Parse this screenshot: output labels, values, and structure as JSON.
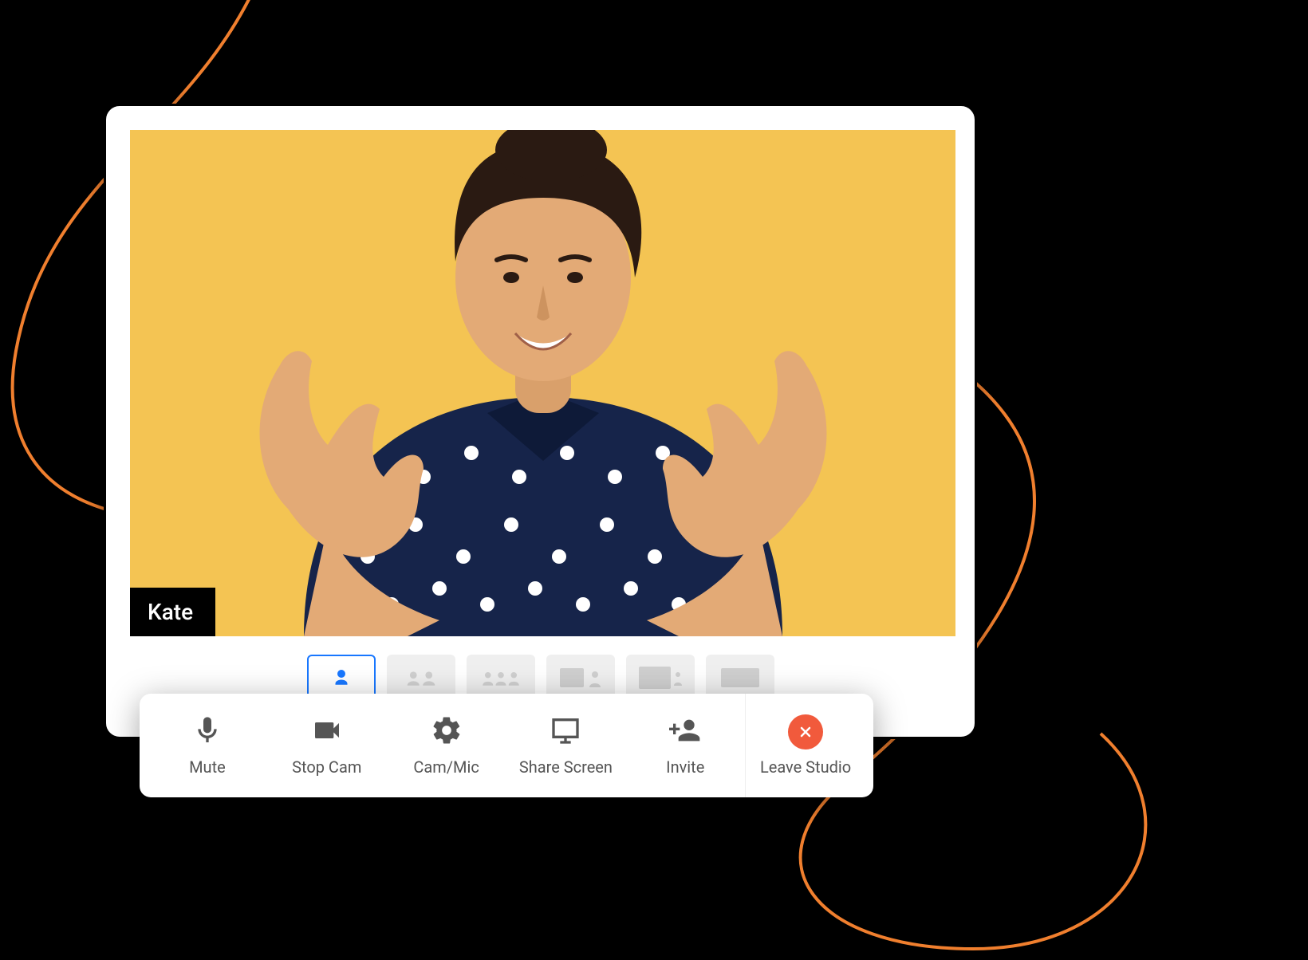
{
  "participant": {
    "name": "Kate"
  },
  "layouts": {
    "active_index": 0,
    "options": [
      "single",
      "two-up",
      "three-up",
      "screen-small",
      "screen-large",
      "screen-only"
    ]
  },
  "toolbar": {
    "mute": {
      "label": "Mute",
      "icon": "mic-icon"
    },
    "stop_cam": {
      "label": "Stop Cam",
      "icon": "camera-icon"
    },
    "cam_mic": {
      "label": "Cam/Mic",
      "icon": "gear-icon"
    },
    "share": {
      "label": "Share Screen",
      "icon": "monitor-icon"
    },
    "invite": {
      "label": "Invite",
      "icon": "add-user-icon"
    },
    "leave": {
      "label": "Leave Studio",
      "icon": "close-icon"
    }
  },
  "colors": {
    "video_bg": "#f4c453",
    "accent": "#1877ff",
    "leave": "#f15a3c",
    "swirl": "#f07f2e"
  }
}
